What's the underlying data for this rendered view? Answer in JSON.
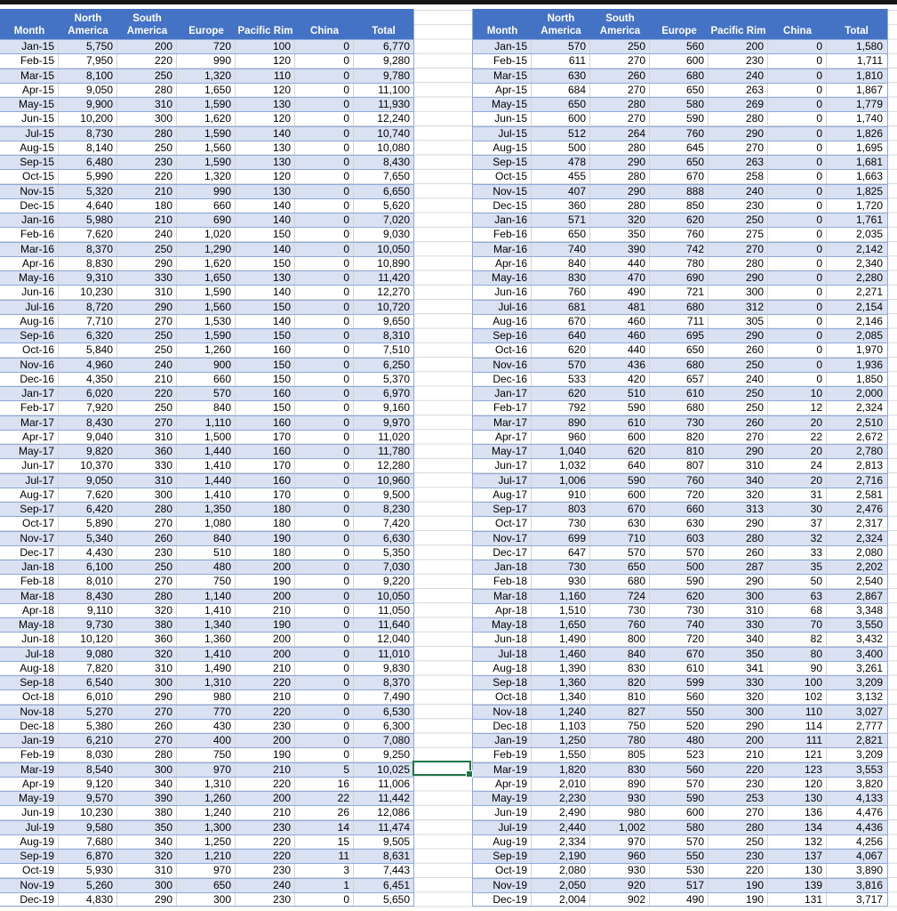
{
  "headers": [
    "Month",
    "North America",
    "South America",
    "Europe",
    "Pacific Rim",
    "China",
    "Total"
  ],
  "colors": {
    "header_bg": "#4472C4",
    "band_row": "#D9E1F2",
    "border": "#8EA9DB",
    "selection": "#217346"
  },
  "tables": [
    {
      "rows": [
        [
          "Jan-15",
          "5,750",
          "200",
          "720",
          "100",
          "0",
          "6,770"
        ],
        [
          "Feb-15",
          "7,950",
          "220",
          "990",
          "120",
          "0",
          "9,280"
        ],
        [
          "Mar-15",
          "8,100",
          "250",
          "1,320",
          "110",
          "0",
          "9,780"
        ],
        [
          "Apr-15",
          "9,050",
          "280",
          "1,650",
          "120",
          "0",
          "11,100"
        ],
        [
          "May-15",
          "9,900",
          "310",
          "1,590",
          "130",
          "0",
          "11,930"
        ],
        [
          "Jun-15",
          "10,200",
          "300",
          "1,620",
          "120",
          "0",
          "12,240"
        ],
        [
          "Jul-15",
          "8,730",
          "280",
          "1,590",
          "140",
          "0",
          "10,740"
        ],
        [
          "Aug-15",
          "8,140",
          "250",
          "1,560",
          "130",
          "0",
          "10,080"
        ],
        [
          "Sep-15",
          "6,480",
          "230",
          "1,590",
          "130",
          "0",
          "8,430"
        ],
        [
          "Oct-15",
          "5,990",
          "220",
          "1,320",
          "120",
          "0",
          "7,650"
        ],
        [
          "Nov-15",
          "5,320",
          "210",
          "990",
          "130",
          "0",
          "6,650"
        ],
        [
          "Dec-15",
          "4,640",
          "180",
          "660",
          "140",
          "0",
          "5,620"
        ],
        [
          "Jan-16",
          "5,980",
          "210",
          "690",
          "140",
          "0",
          "7,020"
        ],
        [
          "Feb-16",
          "7,620",
          "240",
          "1,020",
          "150",
          "0",
          "9,030"
        ],
        [
          "Mar-16",
          "8,370",
          "250",
          "1,290",
          "140",
          "0",
          "10,050"
        ],
        [
          "Apr-16",
          "8,830",
          "290",
          "1,620",
          "150",
          "0",
          "10,890"
        ],
        [
          "May-16",
          "9,310",
          "330",
          "1,650",
          "130",
          "0",
          "11,420"
        ],
        [
          "Jun-16",
          "10,230",
          "310",
          "1,590",
          "140",
          "0",
          "12,270"
        ],
        [
          "Jul-16",
          "8,720",
          "290",
          "1,560",
          "150",
          "0",
          "10,720"
        ],
        [
          "Aug-16",
          "7,710",
          "270",
          "1,530",
          "140",
          "0",
          "9,650"
        ],
        [
          "Sep-16",
          "6,320",
          "250",
          "1,590",
          "150",
          "0",
          "8,310"
        ],
        [
          "Oct-16",
          "5,840",
          "250",
          "1,260",
          "160",
          "0",
          "7,510"
        ],
        [
          "Nov-16",
          "4,960",
          "240",
          "900",
          "150",
          "0",
          "6,250"
        ],
        [
          "Dec-16",
          "4,350",
          "210",
          "660",
          "150",
          "0",
          "5,370"
        ],
        [
          "Jan-17",
          "6,020",
          "220",
          "570",
          "160",
          "0",
          "6,970"
        ],
        [
          "Feb-17",
          "7,920",
          "250",
          "840",
          "150",
          "0",
          "9,160"
        ],
        [
          "Mar-17",
          "8,430",
          "270",
          "1,110",
          "160",
          "0",
          "9,970"
        ],
        [
          "Apr-17",
          "9,040",
          "310",
          "1,500",
          "170",
          "0",
          "11,020"
        ],
        [
          "May-17",
          "9,820",
          "360",
          "1,440",
          "160",
          "0",
          "11,780"
        ],
        [
          "Jun-17",
          "10,370",
          "330",
          "1,410",
          "170",
          "0",
          "12,280"
        ],
        [
          "Jul-17",
          "9,050",
          "310",
          "1,440",
          "160",
          "0",
          "10,960"
        ],
        [
          "Aug-17",
          "7,620",
          "300",
          "1,410",
          "170",
          "0",
          "9,500"
        ],
        [
          "Sep-17",
          "6,420",
          "280",
          "1,350",
          "180",
          "0",
          "8,230"
        ],
        [
          "Oct-17",
          "5,890",
          "270",
          "1,080",
          "180",
          "0",
          "7,420"
        ],
        [
          "Nov-17",
          "5,340",
          "260",
          "840",
          "190",
          "0",
          "6,630"
        ],
        [
          "Dec-17",
          "4,430",
          "230",
          "510",
          "180",
          "0",
          "5,350"
        ],
        [
          "Jan-18",
          "6,100",
          "250",
          "480",
          "200",
          "0",
          "7,030"
        ],
        [
          "Feb-18",
          "8,010",
          "270",
          "750",
          "190",
          "0",
          "9,220"
        ],
        [
          "Mar-18",
          "8,430",
          "280",
          "1,140",
          "200",
          "0",
          "10,050"
        ],
        [
          "Apr-18",
          "9,110",
          "320",
          "1,410",
          "210",
          "0",
          "11,050"
        ],
        [
          "May-18",
          "9,730",
          "380",
          "1,340",
          "190",
          "0",
          "11,640"
        ],
        [
          "Jun-18",
          "10,120",
          "360",
          "1,360",
          "200",
          "0",
          "12,040"
        ],
        [
          "Jul-18",
          "9,080",
          "320",
          "1,410",
          "200",
          "0",
          "11,010"
        ],
        [
          "Aug-18",
          "7,820",
          "310",
          "1,490",
          "210",
          "0",
          "9,830"
        ],
        [
          "Sep-18",
          "6,540",
          "300",
          "1,310",
          "220",
          "0",
          "8,370"
        ],
        [
          "Oct-18",
          "6,010",
          "290",
          "980",
          "210",
          "0",
          "7,490"
        ],
        [
          "Nov-18",
          "5,270",
          "270",
          "770",
          "220",
          "0",
          "6,530"
        ],
        [
          "Dec-18",
          "5,380",
          "260",
          "430",
          "230",
          "0",
          "6,300"
        ],
        [
          "Jan-19",
          "6,210",
          "270",
          "400",
          "200",
          "0",
          "7,080"
        ],
        [
          "Feb-19",
          "8,030",
          "280",
          "750",
          "190",
          "0",
          "9,250"
        ],
        [
          "Mar-19",
          "8,540",
          "300",
          "970",
          "210",
          "5",
          "10,025"
        ],
        [
          "Apr-19",
          "9,120",
          "340",
          "1,310",
          "220",
          "16",
          "11,006"
        ],
        [
          "May-19",
          "9,570",
          "390",
          "1,260",
          "200",
          "22",
          "11,442"
        ],
        [
          "Jun-19",
          "10,230",
          "380",
          "1,240",
          "210",
          "26",
          "12,086"
        ],
        [
          "Jul-19",
          "9,580",
          "350",
          "1,300",
          "230",
          "14",
          "11,474"
        ],
        [
          "Aug-19",
          "7,680",
          "340",
          "1,250",
          "220",
          "15",
          "9,505"
        ],
        [
          "Sep-19",
          "6,870",
          "320",
          "1,210",
          "220",
          "11",
          "8,631"
        ],
        [
          "Oct-19",
          "5,930",
          "310",
          "970",
          "230",
          "3",
          "7,443"
        ],
        [
          "Nov-19",
          "5,260",
          "300",
          "650",
          "240",
          "1",
          "6,451"
        ],
        [
          "Dec-19",
          "4,830",
          "290",
          "300",
          "230",
          "0",
          "5,650"
        ]
      ]
    },
    {
      "rows": [
        [
          "Jan-15",
          "570",
          "250",
          "560",
          "200",
          "0",
          "1,580"
        ],
        [
          "Feb-15",
          "611",
          "270",
          "600",
          "230",
          "0",
          "1,711"
        ],
        [
          "Mar-15",
          "630",
          "260",
          "680",
          "240",
          "0",
          "1,810"
        ],
        [
          "Apr-15",
          "684",
          "270",
          "650",
          "263",
          "0",
          "1,867"
        ],
        [
          "May-15",
          "650",
          "280",
          "580",
          "269",
          "0",
          "1,779"
        ],
        [
          "Jun-15",
          "600",
          "270",
          "590",
          "280",
          "0",
          "1,740"
        ],
        [
          "Jul-15",
          "512",
          "264",
          "760",
          "290",
          "0",
          "1,826"
        ],
        [
          "Aug-15",
          "500",
          "280",
          "645",
          "270",
          "0",
          "1,695"
        ],
        [
          "Sep-15",
          "478",
          "290",
          "650",
          "263",
          "0",
          "1,681"
        ],
        [
          "Oct-15",
          "455",
          "280",
          "670",
          "258",
          "0",
          "1,663"
        ],
        [
          "Nov-15",
          "407",
          "290",
          "888",
          "240",
          "0",
          "1,825"
        ],
        [
          "Dec-15",
          "360",
          "280",
          "850",
          "230",
          "0",
          "1,720"
        ],
        [
          "Jan-16",
          "571",
          "320",
          "620",
          "250",
          "0",
          "1,761"
        ],
        [
          "Feb-16",
          "650",
          "350",
          "760",
          "275",
          "0",
          "2,035"
        ],
        [
          "Mar-16",
          "740",
          "390",
          "742",
          "270",
          "0",
          "2,142"
        ],
        [
          "Apr-16",
          "840",
          "440",
          "780",
          "280",
          "0",
          "2,340"
        ],
        [
          "May-16",
          "830",
          "470",
          "690",
          "290",
          "0",
          "2,280"
        ],
        [
          "Jun-16",
          "760",
          "490",
          "721",
          "300",
          "0",
          "2,271"
        ],
        [
          "Jul-16",
          "681",
          "481",
          "680",
          "312",
          "0",
          "2,154"
        ],
        [
          "Aug-16",
          "670",
          "460",
          "711",
          "305",
          "0",
          "2,146"
        ],
        [
          "Sep-16",
          "640",
          "460",
          "695",
          "290",
          "0",
          "2,085"
        ],
        [
          "Oct-16",
          "620",
          "440",
          "650",
          "260",
          "0",
          "1,970"
        ],
        [
          "Nov-16",
          "570",
          "436",
          "680",
          "250",
          "0",
          "1,936"
        ],
        [
          "Dec-16",
          "533",
          "420",
          "657",
          "240",
          "0",
          "1,850"
        ],
        [
          "Jan-17",
          "620",
          "510",
          "610",
          "250",
          "10",
          "2,000"
        ],
        [
          "Feb-17",
          "792",
          "590",
          "680",
          "250",
          "12",
          "2,324"
        ],
        [
          "Mar-17",
          "890",
          "610",
          "730",
          "260",
          "20",
          "2,510"
        ],
        [
          "Apr-17",
          "960",
          "600",
          "820",
          "270",
          "22",
          "2,672"
        ],
        [
          "May-17",
          "1,040",
          "620",
          "810",
          "290",
          "20",
          "2,780"
        ],
        [
          "Jun-17",
          "1,032",
          "640",
          "807",
          "310",
          "24",
          "2,813"
        ],
        [
          "Jul-17",
          "1,006",
          "590",
          "760",
          "340",
          "20",
          "2,716"
        ],
        [
          "Aug-17",
          "910",
          "600",
          "720",
          "320",
          "31",
          "2,581"
        ],
        [
          "Sep-17",
          "803",
          "670",
          "660",
          "313",
          "30",
          "2,476"
        ],
        [
          "Oct-17",
          "730",
          "630",
          "630",
          "290",
          "37",
          "2,317"
        ],
        [
          "Nov-17",
          "699",
          "710",
          "603",
          "280",
          "32",
          "2,324"
        ],
        [
          "Dec-17",
          "647",
          "570",
          "570",
          "260",
          "33",
          "2,080"
        ],
        [
          "Jan-18",
          "730",
          "650",
          "500",
          "287",
          "35",
          "2,202"
        ],
        [
          "Feb-18",
          "930",
          "680",
          "590",
          "290",
          "50",
          "2,540"
        ],
        [
          "Mar-18",
          "1,160",
          "724",
          "620",
          "300",
          "63",
          "2,867"
        ],
        [
          "Apr-18",
          "1,510",
          "730",
          "730",
          "310",
          "68",
          "3,348"
        ],
        [
          "May-18",
          "1,650",
          "760",
          "740",
          "330",
          "70",
          "3,550"
        ],
        [
          "Jun-18",
          "1,490",
          "800",
          "720",
          "340",
          "82",
          "3,432"
        ],
        [
          "Jul-18",
          "1,460",
          "840",
          "670",
          "350",
          "80",
          "3,400"
        ],
        [
          "Aug-18",
          "1,390",
          "830",
          "610",
          "341",
          "90",
          "3,261"
        ],
        [
          "Sep-18",
          "1,360",
          "820",
          "599",
          "330",
          "100",
          "3,209"
        ],
        [
          "Oct-18",
          "1,340",
          "810",
          "560",
          "320",
          "102",
          "3,132"
        ],
        [
          "Nov-18",
          "1,240",
          "827",
          "550",
          "300",
          "110",
          "3,027"
        ],
        [
          "Dec-18",
          "1,103",
          "750",
          "520",
          "290",
          "114",
          "2,777"
        ],
        [
          "Jan-19",
          "1,250",
          "780",
          "480",
          "200",
          "111",
          "2,821"
        ],
        [
          "Feb-19",
          "1,550",
          "805",
          "523",
          "210",
          "121",
          "3,209"
        ],
        [
          "Mar-19",
          "1,820",
          "830",
          "560",
          "220",
          "123",
          "3,553"
        ],
        [
          "Apr-19",
          "2,010",
          "890",
          "570",
          "230",
          "120",
          "3,820"
        ],
        [
          "May-19",
          "2,230",
          "930",
          "590",
          "253",
          "130",
          "4,133"
        ],
        [
          "Jun-19",
          "2,490",
          "980",
          "600",
          "270",
          "136",
          "4,476"
        ],
        [
          "Jul-19",
          "2,440",
          "1,002",
          "580",
          "280",
          "134",
          "4,436"
        ],
        [
          "Aug-19",
          "2,334",
          "970",
          "570",
          "250",
          "132",
          "4,256"
        ],
        [
          "Sep-19",
          "2,190",
          "960",
          "550",
          "230",
          "137",
          "4,067"
        ],
        [
          "Oct-19",
          "2,080",
          "930",
          "530",
          "220",
          "130",
          "3,890"
        ],
        [
          "Nov-19",
          "2,050",
          "920",
          "517",
          "190",
          "139",
          "3,816"
        ],
        [
          "Dec-19",
          "2,004",
          "902",
          "490",
          "190",
          "131",
          "3,717"
        ]
      ]
    }
  ]
}
